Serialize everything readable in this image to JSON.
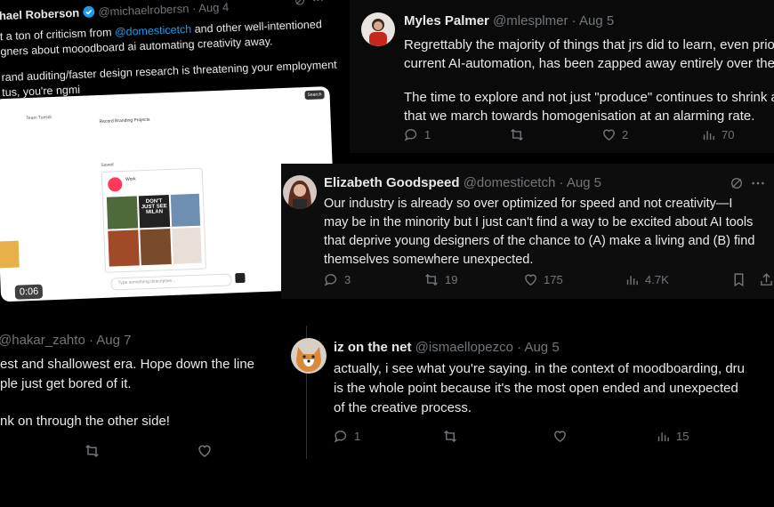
{
  "tweet_roberson": {
    "name": "hael Roberson",
    "handle": "@michaelrobersn",
    "date": "· Aug 4",
    "line1_pre": "t a ton of criticism from ",
    "line1_link": "@domesticetch",
    "line1_post": " and other well-intentioned",
    "line2": "gners about mooodboard ai automating creativity away.",
    "line3": "rand auditing/faster design research is threatening your employment",
    "line4": "tus, you're ngmi",
    "video_time": "0:06",
    "embed_label": "Team Tuesdi",
    "embed_project": "Record Branding Projects",
    "embed_cta": "Search",
    "embed_section": "Saved",
    "embed_card_title": "Work",
    "embed_tile_text": "DON'T JUST SEE MILAN",
    "embed_input_placeholder": "Type something descriptive..."
  },
  "tweet_palmer": {
    "name": "Myles Palmer",
    "handle": "@mlesplmer",
    "date": "· Aug 5",
    "line1": "Regrettably the majority of things that jrs did to learn, even prior",
    "line2": "current AI-automation, has been zapped away entirely over the l",
    "line3": "The time to explore and not just \"produce\" continues to shrink a",
    "line4": "that we march towards homogenisation at an alarming rate.",
    "replies": "1",
    "likes": "2",
    "views": "70"
  },
  "tweet_goodspeed": {
    "name": "Elizabeth Goodspeed",
    "handle": "@domesticetch",
    "date": "· Aug 5",
    "line1": "Our industry is already so over optimized for speed and not creativity—I",
    "line2": "may be in the minority but I just can't find a way to be excited about AI tools",
    "line3": "that deprive young designers of the chance to (A) make a living and (B) find",
    "line4": "themselves somewhere unexpected.",
    "replies": "3",
    "reposts": "19",
    "likes": "175",
    "views": "4.7K"
  },
  "tweet_zahto": {
    "handle": "@hakar_zahto",
    "date": "· Aug 7",
    "line1": "est and shallowest era. Hope down the line",
    "line2": "ple just get bored of it.",
    "line3": "nk on through the other side!"
  },
  "tweet_iz": {
    "name": "iz on the net",
    "handle": "@ismaellopezco",
    "date": "· Aug 5",
    "line1": "actually, i see what you're saying. in the context of moodboarding, dru",
    "line2": "is the whole point because it's the most open ended and unexpected",
    "line3": "of the creative process.",
    "replies": "1",
    "views": "15"
  },
  "colors": {
    "bg": "#000000",
    "text": "#e7e9ea",
    "muted": "#71767b",
    "link": "#1d9bf0",
    "verified": "#1d9bf0"
  }
}
